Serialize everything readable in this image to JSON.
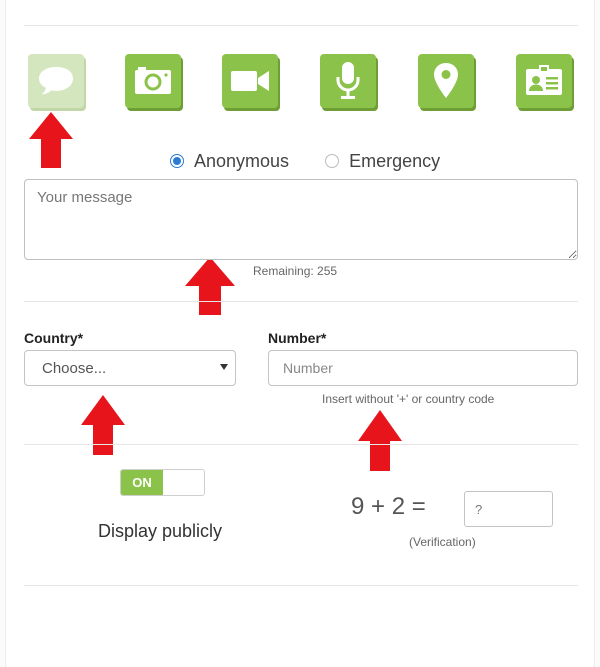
{
  "attachments": [
    {
      "name": "message-icon",
      "selected": true
    },
    {
      "name": "camera-icon",
      "selected": false
    },
    {
      "name": "video-camera-icon",
      "selected": false
    },
    {
      "name": "microphone-icon",
      "selected": false
    },
    {
      "name": "location-pin-icon",
      "selected": false
    },
    {
      "name": "contact-card-icon",
      "selected": false
    }
  ],
  "report_type": {
    "options": [
      "Anonymous",
      "Emergency"
    ],
    "selected": "Anonymous"
  },
  "message": {
    "placeholder": "Your message",
    "value": "",
    "remaining_text": "Remaining: 255"
  },
  "country": {
    "label": "Country*",
    "selected": "Choose..."
  },
  "number": {
    "label": "Number*",
    "placeholder": "Number",
    "value": "",
    "hint": "Insert without '+' or country code"
  },
  "display_publicly": {
    "toggle_label": "ON",
    "label": "Display publicly"
  },
  "verification": {
    "question": "9 + 2 =",
    "placeholder": "?",
    "caption": "(Verification)"
  },
  "colors": {
    "brand_green": "#8bc34a",
    "annotation_red": "#e8141c",
    "radio_blue": "#2b7bd3"
  }
}
